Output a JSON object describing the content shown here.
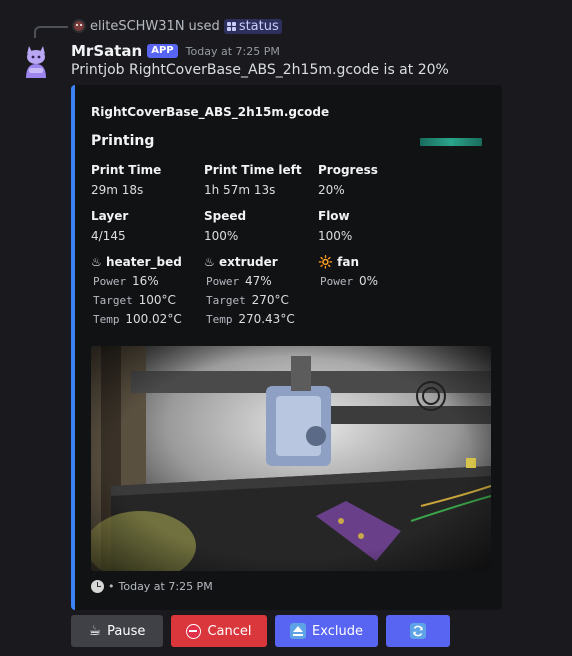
{
  "reply": {
    "user": "eliteSCHW31N",
    "used_text": "used",
    "command": "status"
  },
  "message": {
    "author": "MrSatan",
    "badge": "APP",
    "timestamp": "Today at 7:25 PM",
    "content": "Printjob RightCoverBase_ABS_2h15m.gcode is at 20%"
  },
  "embed": {
    "accent_color": "#3b82f6",
    "author": "RightCoverBase_ABS_2h15m.gcode",
    "title": "Printing",
    "progress_fraction": 0.2,
    "fields": [
      {
        "name": "Print Time",
        "value": "29m 18s"
      },
      {
        "name": "Print Time left",
        "value": "1h 57m 13s"
      },
      {
        "name": "Progress",
        "value": "20%"
      },
      {
        "name": "Layer",
        "value": "4/145"
      },
      {
        "name": "Speed",
        "value": "100%"
      },
      {
        "name": "Flow",
        "value": "100%"
      }
    ],
    "heaters": [
      {
        "icon": "♨",
        "name": "heater_bed",
        "power_key": "Power",
        "power": "16%",
        "target_key": "Target",
        "target": "100°C",
        "temp_key": "Temp",
        "temp": "100.02°C"
      },
      {
        "icon": "♨",
        "name": "extruder",
        "power_key": "Power",
        "power": "47%",
        "target_key": "Target",
        "target": "270°C",
        "temp_key": "Temp",
        "temp": "270.43°C"
      }
    ],
    "fan": {
      "icon": "🔆",
      "name": "fan",
      "power_key": "Power",
      "power": "0%"
    },
    "footer": {
      "separator": "•",
      "timestamp": "Today at 7:25 PM"
    }
  },
  "buttons": {
    "pause": "Pause",
    "cancel": "Cancel",
    "exclude": "Exclude"
  },
  "icons": {
    "pause": "coffee-icon",
    "cancel": "no-entry-icon",
    "exclude": "eject-icon",
    "refresh": "refresh-icon",
    "footer": "clock-icon"
  }
}
